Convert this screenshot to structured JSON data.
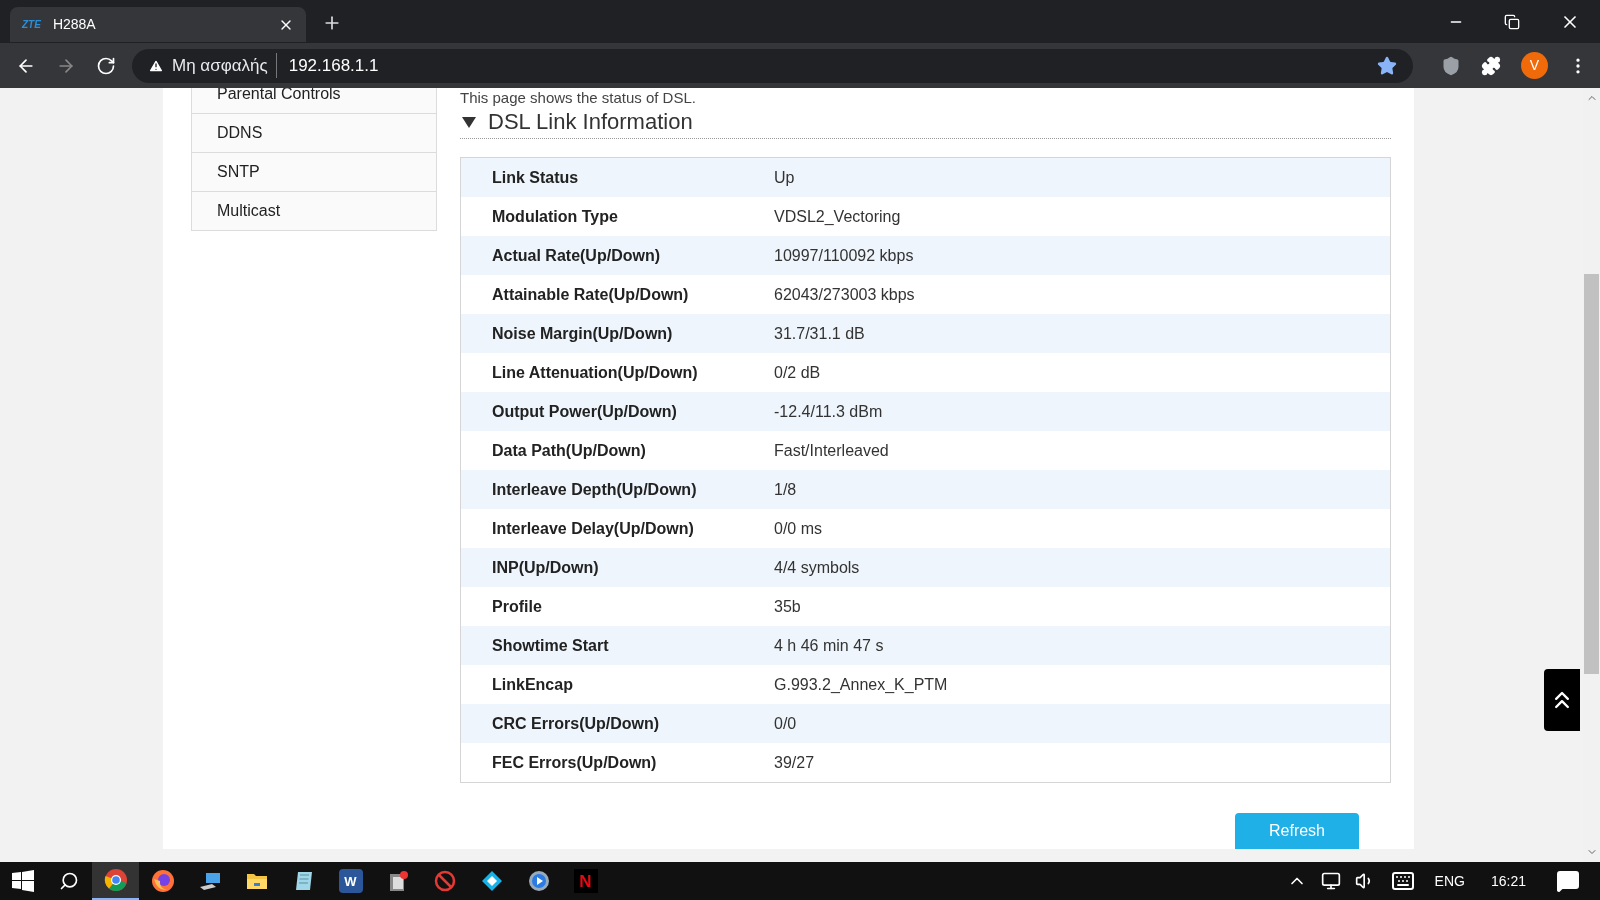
{
  "browser": {
    "tab": {
      "favicon": "ZTE",
      "title": "H288A"
    },
    "address": {
      "security": "Μη ασφαλής",
      "url": "192.168.1.1"
    },
    "profile": "V"
  },
  "sidebar": {
    "items": [
      {
        "label": "Parental Controls",
        "selected": false
      },
      {
        "label": "DDNS",
        "selected": false
      },
      {
        "label": "SNTP",
        "selected": false
      },
      {
        "label": "Multicast",
        "selected": false
      }
    ]
  },
  "page": {
    "intro": "This page shows the status of DSL.",
    "section": {
      "title": "DSL Link Information",
      "expanded": true
    },
    "rows": [
      {
        "label": "Link Status",
        "value": "Up"
      },
      {
        "label": "Modulation Type",
        "value": "VDSL2_Vectoring"
      },
      {
        "label": "Actual Rate(Up/Down)",
        "value": "10997/110092 kbps"
      },
      {
        "label": "Attainable Rate(Up/Down)",
        "value": "62043/273003 kbps"
      },
      {
        "label": "Noise Margin(Up/Down)",
        "value": "31.7/31.1 dB"
      },
      {
        "label": "Line Attenuation(Up/Down)",
        "value": "0/2 dB"
      },
      {
        "label": "Output Power(Up/Down)",
        "value": "-12.4/11.3 dBm"
      },
      {
        "label": "Data Path(Up/Down)",
        "value": "Fast/Interleaved"
      },
      {
        "label": "Interleave Depth(Up/Down)",
        "value": "1/8"
      },
      {
        "label": "Interleave Delay(Up/Down)",
        "value": "0/0 ms"
      },
      {
        "label": "INP(Up/Down)",
        "value": "4/4 symbols"
      },
      {
        "label": "Profile",
        "value": "35b"
      },
      {
        "label": "Showtime Start",
        "value": "4 h 46 min 47 s"
      },
      {
        "label": "LinkEncap",
        "value": "G.993.2_Annex_K_PTM"
      },
      {
        "label": "CRC Errors(Up/Down)",
        "value": "0/0"
      },
      {
        "label": "FEC Errors(Up/Down)",
        "value": "39/27"
      }
    ],
    "refresh_button": "Refresh"
  },
  "taskbar": {
    "apps": [
      {
        "kind": "chrome",
        "selected": true
      },
      {
        "kind": "firefox",
        "selected": false
      },
      {
        "kind": "computer",
        "selected": false
      },
      {
        "kind": "folder",
        "selected": false
      },
      {
        "kind": "notepad",
        "selected": false
      },
      {
        "kind": "word",
        "selected": false,
        "glyph": "W"
      },
      {
        "kind": "archive",
        "selected": false
      },
      {
        "kind": "blocked",
        "selected": false
      },
      {
        "kind": "kodi",
        "selected": false
      },
      {
        "kind": "player",
        "selected": false
      },
      {
        "kind": "netflix",
        "selected": false,
        "glyph": "N"
      }
    ],
    "language": "ENG",
    "time": "16:21"
  }
}
